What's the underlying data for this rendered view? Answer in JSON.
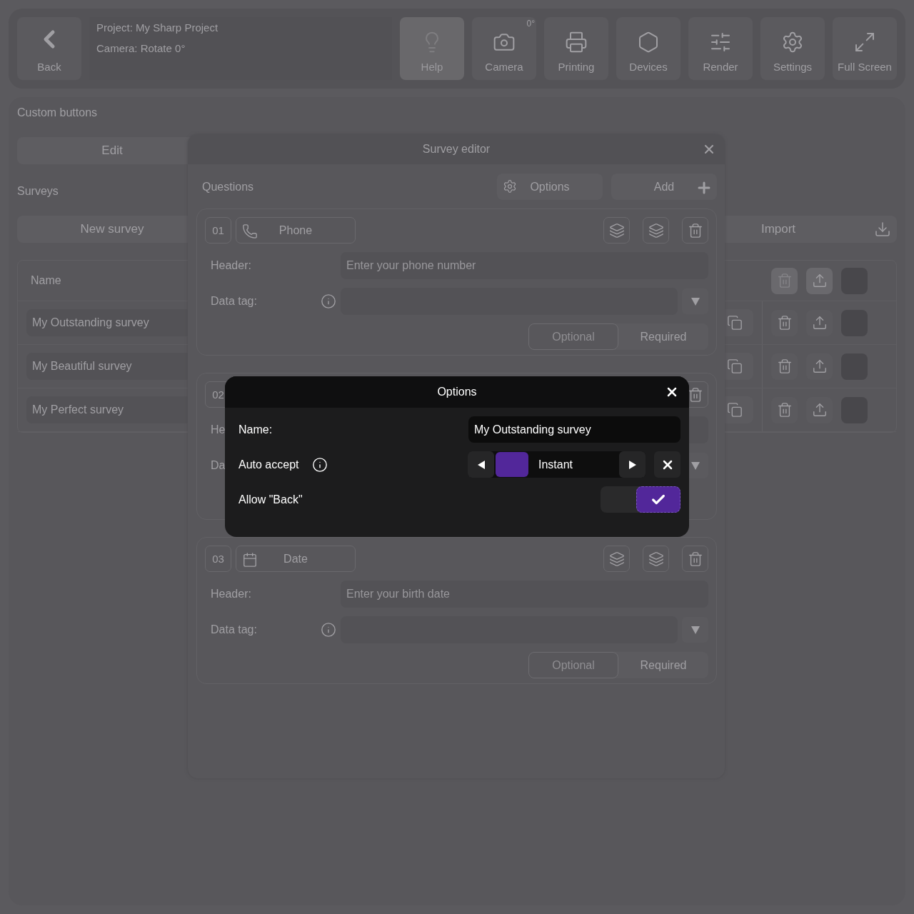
{
  "topbar": {
    "back": "Back",
    "project": "Project: My Sharp Project",
    "camera": "Camera: Rotate 0°",
    "tools": [
      {
        "label": "Help",
        "kind": "help",
        "selected": true
      },
      {
        "label": "Camera",
        "kind": "camera",
        "badge": "0°",
        "selected": false
      },
      {
        "label": "Printing",
        "kind": "printing",
        "selected": false
      },
      {
        "label": "Devices",
        "kind": "devices",
        "selected": false
      },
      {
        "label": "Render",
        "kind": "render",
        "selected": false
      },
      {
        "label": "Settings",
        "kind": "settings",
        "selected": false
      },
      {
        "label": "Full Screen",
        "kind": "fullscreen",
        "selected": false
      }
    ]
  },
  "custom_buttons": {
    "title": "Custom buttons",
    "edit_button": "Edit"
  },
  "surveys": {
    "title": "Surveys",
    "new_button": "New survey",
    "import_button": "Import",
    "columns": [
      "Name"
    ],
    "rows": [
      {
        "name": "My Outstanding survey"
      },
      {
        "name": "My Beautiful survey"
      },
      {
        "name": "My Perfect survey"
      }
    ]
  },
  "survey_editor": {
    "title": "Survey editor",
    "questions_label": "Questions",
    "options_button": "Options",
    "add_button": "Add",
    "questions": [
      {
        "number": "01",
        "kind": "phone",
        "type": "Phone",
        "header_label": "Header:",
        "header_placeholder": "Enter your phone number",
        "datatag_label": "Data tag:",
        "requirement": [
          {
            "label": "Optional",
            "selected": true
          },
          {
            "label": "Required",
            "selected": false
          }
        ]
      },
      {
        "number": "02",
        "header_label": "He",
        "datatag_label": "Da"
      },
      {
        "number": "03",
        "kind": "date",
        "type": "Date",
        "header_label": "Header:",
        "header_placeholder": "Enter your birth date",
        "datatag_label": "Data tag:",
        "requirement": [
          {
            "label": "Optional",
            "selected": true
          },
          {
            "label": "Required",
            "selected": false
          }
        ]
      }
    ]
  },
  "options_dialog": {
    "title": "Options",
    "name_label": "Name:",
    "name_value": "My Outstanding survey",
    "auto_accept_label": "Auto accept",
    "auto_accept_value": "Instant",
    "allow_back_label": "Allow \"Back\"",
    "allow_back_checked": true
  }
}
